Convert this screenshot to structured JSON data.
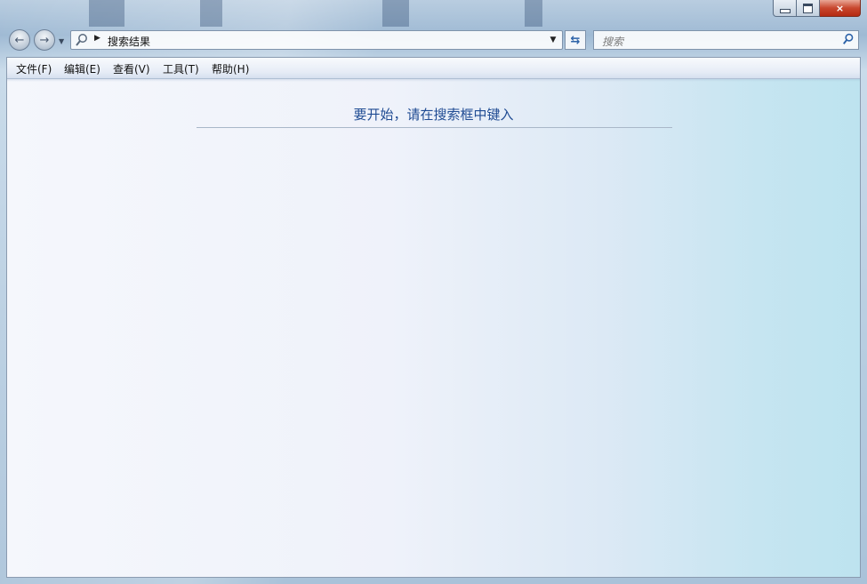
{
  "window": {
    "caption": {
      "minimize": "minimize",
      "maximize": "maximize",
      "close": "×"
    }
  },
  "nav": {
    "back_icon": "back-arrow-icon",
    "forward_icon": "forward-arrow-icon"
  },
  "address": {
    "path": "搜索结果"
  },
  "search": {
    "placeholder": "搜索"
  },
  "menu": {
    "items": [
      {
        "label": "文件(F)"
      },
      {
        "label": "编辑(E)"
      },
      {
        "label": "查看(V)"
      },
      {
        "label": "工具(T)"
      },
      {
        "label": "帮助(H)"
      }
    ]
  },
  "content": {
    "hint": "要开始，请在搜索框中键入"
  },
  "colors": {
    "hint_text": "#1f4b93",
    "close_button": "#c8472e",
    "accent_icon": "#2c62a8"
  }
}
